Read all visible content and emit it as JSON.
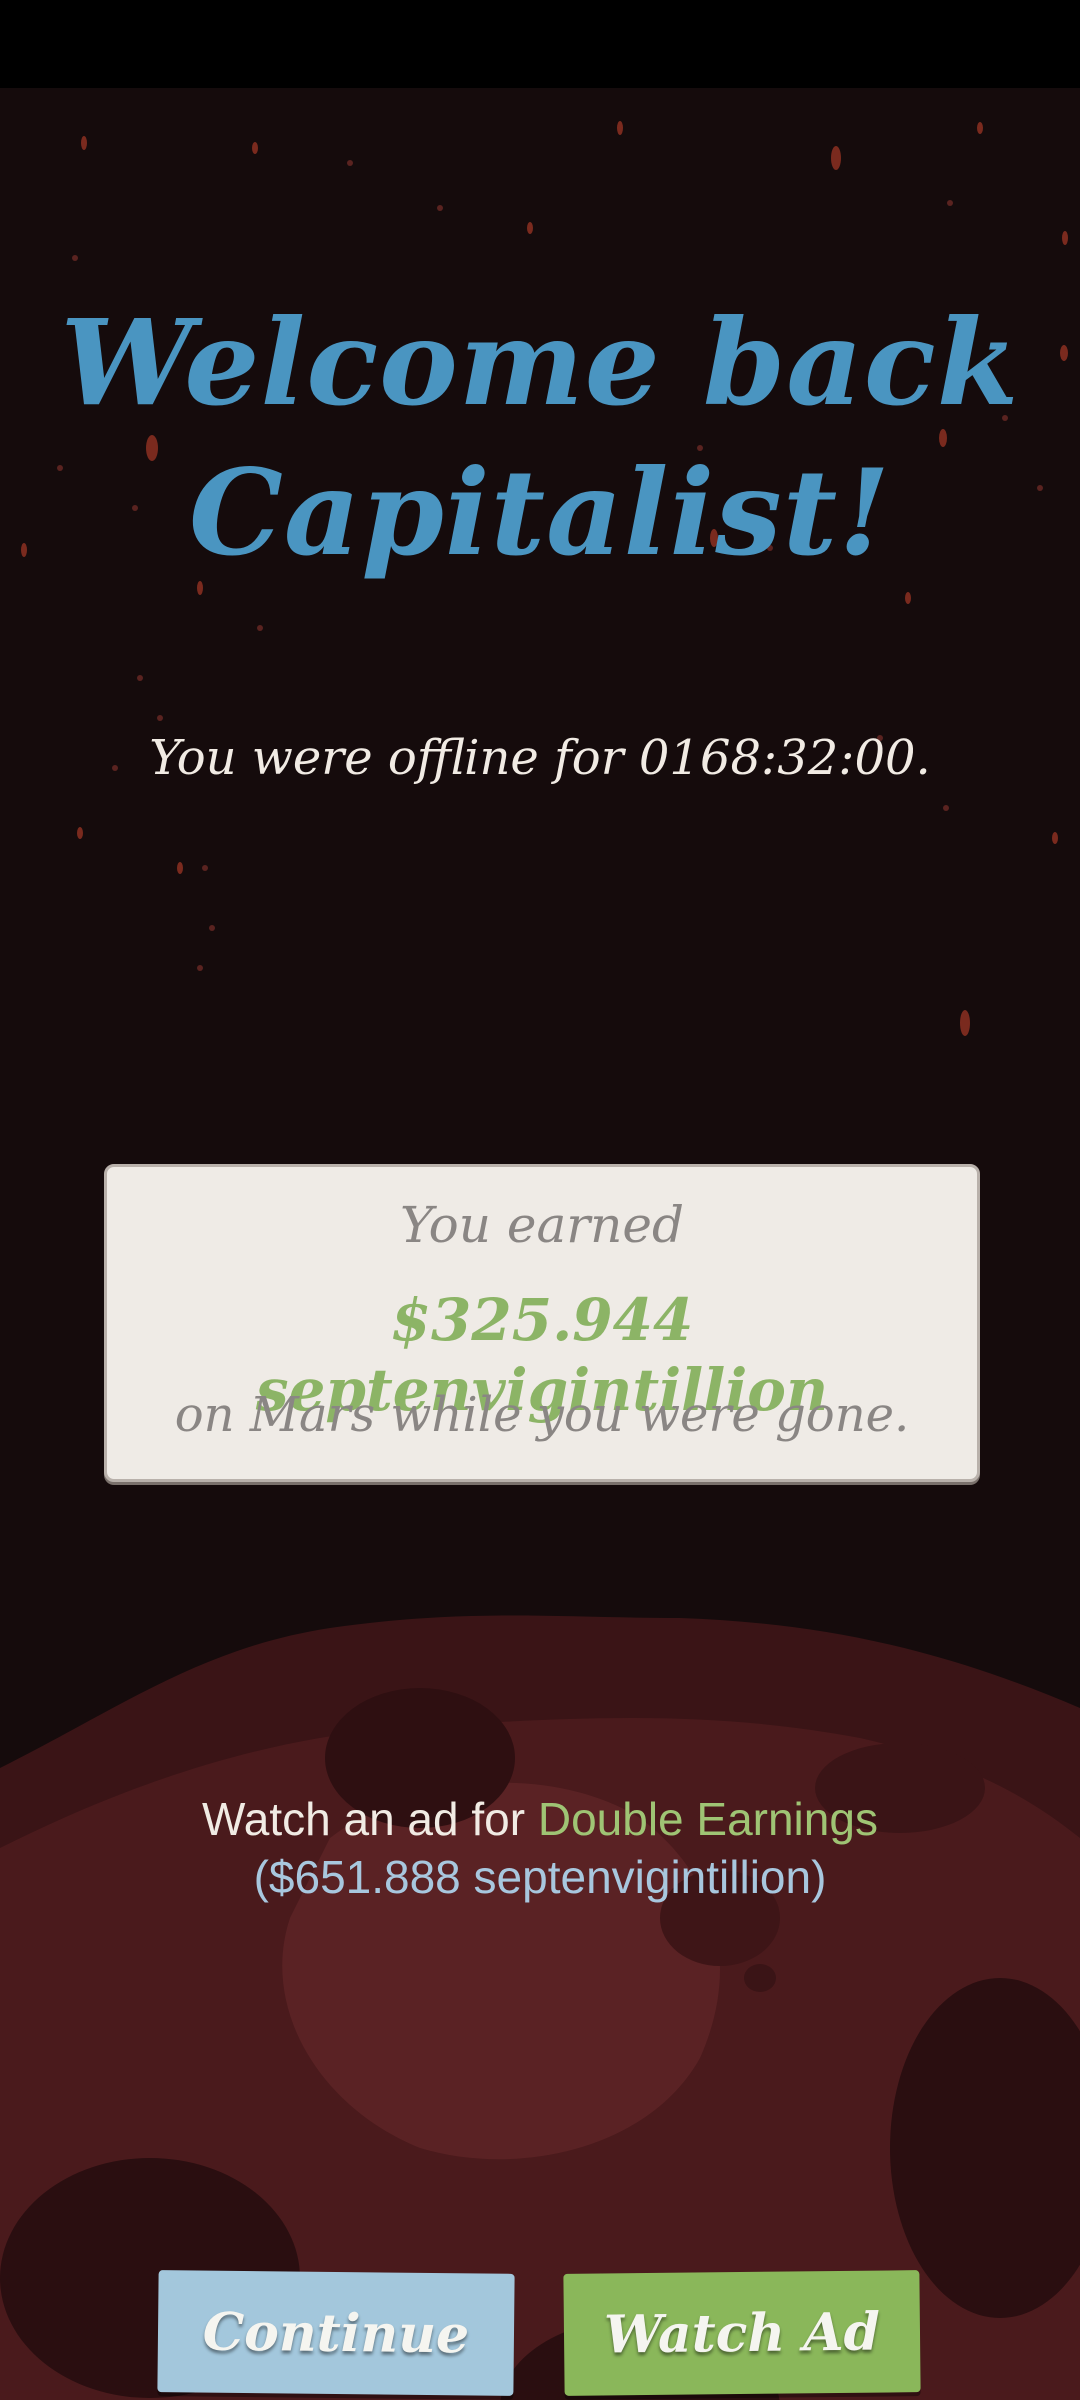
{
  "welcome": {
    "title_line1": "Welcome back",
    "title_line2": "Capitalist!"
  },
  "offline": {
    "text": "You were offline for 0168:32:00."
  },
  "earnings": {
    "label": "You earned",
    "amount": "$325.944 septenvigintillion",
    "location_text": "on Mars while you were gone."
  },
  "ad_offer": {
    "prefix": "Watch an ad for ",
    "highlight": "Double Earnings",
    "value": "($651.888 septenvigintillion)"
  },
  "buttons": {
    "continue_label": "Continue",
    "watch_ad_label": "Watch Ad"
  },
  "colors": {
    "background": "#150b0c",
    "title": "#4a95c1",
    "amount_green": "#8cb466",
    "continue_button": "#a3c7dc",
    "watch_ad_button": "#8ab75a",
    "planet": "#4a1a1c"
  }
}
